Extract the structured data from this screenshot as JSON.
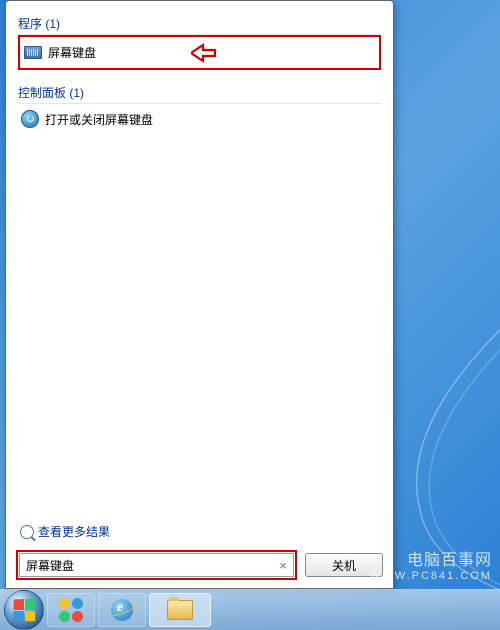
{
  "categories": {
    "programs": {
      "header": "程序 (1)"
    },
    "controlPanel": {
      "header": "控制面板 (1)"
    }
  },
  "results": {
    "osk": {
      "label": "屏幕键盘"
    },
    "toggleOsk": {
      "label": "打开或关闭屏幕键盘"
    }
  },
  "moreResults": "查看更多结果",
  "search": {
    "value": "屏幕键盘"
  },
  "shutdown": {
    "label": "关机"
  },
  "watermark": {
    "line1": "电脑百事网",
    "line2": "WWW.PC841.COM"
  }
}
